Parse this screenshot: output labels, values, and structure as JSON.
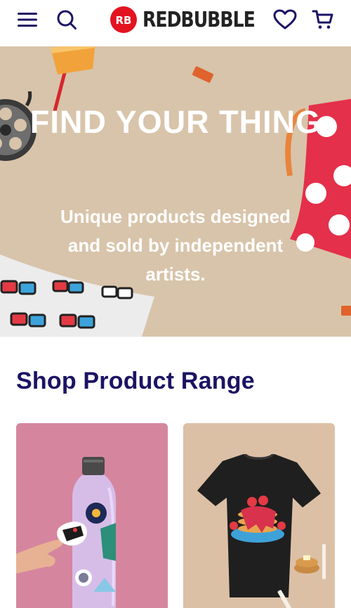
{
  "header": {
    "brand_name": "REDBUBBLE",
    "icons": {
      "menu": "hamburger-menu-icon",
      "search": "search-icon",
      "logo": "redbubble-logo-icon",
      "wishlist": "heart-icon",
      "cart": "cart-icon"
    }
  },
  "hero": {
    "title": "FIND YOUR THING",
    "subtitle": "Unique products designed and sold by independent artists.",
    "background_color": "#d8c4aa"
  },
  "product_range": {
    "title": "Shop Product Range",
    "cards": [
      {
        "image": "water-bottle-stickers",
        "background_color": "#d5869e"
      },
      {
        "image": "pancake-t-shirt",
        "background_color": "#dcc0a6"
      }
    ]
  },
  "colors": {
    "brand_red": "#e41321",
    "heading_navy": "#1b1464",
    "hero_text": "#ffffff"
  }
}
